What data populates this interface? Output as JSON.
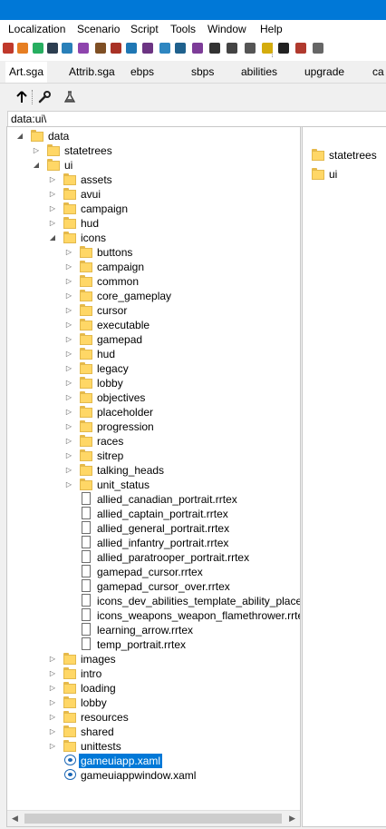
{
  "menu": [
    "Localization",
    "Scenario",
    "Script",
    "Tools",
    "Window",
    "Help"
  ],
  "toolbar_icons": [
    {
      "name": "red-cube-icon",
      "color": "#c0392b"
    },
    {
      "name": "palette-icon",
      "color": "#e67e22"
    },
    {
      "name": "plant-icon",
      "color": "#27ae60"
    },
    {
      "name": "swap-arrows-icon",
      "color": "#2c3e50"
    },
    {
      "name": "marker-icon",
      "color": "#2980b9"
    },
    {
      "name": "image-edit-icon",
      "color": "#8e44ad"
    },
    {
      "name": "grid-icon",
      "color": "#7f4f24"
    },
    {
      "name": "brush-icon",
      "color": "#a93226"
    },
    {
      "name": "snowflake-icon",
      "color": "#1f77b4"
    },
    {
      "name": "shield-icon",
      "color": "#6c3483"
    },
    {
      "name": "water-drop-icon",
      "color": "#2e86c1"
    },
    {
      "name": "wave-icon",
      "color": "#1f618d"
    },
    {
      "name": "chart-icon",
      "color": "#7d3c98"
    },
    {
      "name": "target-icon",
      "color": "#333333"
    },
    {
      "name": "bounding-box-icon",
      "color": "#444444"
    },
    {
      "name": "speaker-icon",
      "color": "#555555"
    },
    {
      "name": "lightbulb-icon",
      "color": "#d4ac0d"
    },
    {
      "name": "bomb-icon",
      "color": "#222222"
    },
    {
      "name": "flag-icon",
      "color": "#b03a2e"
    },
    {
      "name": "lock-icon",
      "color": "#666666"
    }
  ],
  "tabs": [
    "Art.sga",
    "Attrib.sga",
    "ebps",
    "sbps",
    "abilities",
    "upgrade",
    "ca"
  ],
  "subtoolbar": {
    "up_icon": "up-arrow-icon",
    "wrench_icon": "wrench-icon",
    "flask_icon": "flask-icon"
  },
  "path": "data:ui\\",
  "tree": [
    {
      "label": "data",
      "level": 0,
      "type": "folder",
      "expander": "open"
    },
    {
      "label": "statetrees",
      "level": 1,
      "type": "folder",
      "expander": "closed"
    },
    {
      "label": "ui",
      "level": 1,
      "type": "folder",
      "expander": "open"
    },
    {
      "label": "assets",
      "level": 2,
      "type": "folder",
      "expander": "closed"
    },
    {
      "label": "avui",
      "level": 2,
      "type": "folder",
      "expander": "closed"
    },
    {
      "label": "campaign",
      "level": 2,
      "type": "folder",
      "expander": "closed"
    },
    {
      "label": "hud",
      "level": 2,
      "type": "folder",
      "expander": "closed"
    },
    {
      "label": "icons",
      "level": 2,
      "type": "folder",
      "expander": "open"
    },
    {
      "label": "buttons",
      "level": 3,
      "type": "folder",
      "expander": "closed"
    },
    {
      "label": "campaign",
      "level": 3,
      "type": "folder",
      "expander": "closed"
    },
    {
      "label": "common",
      "level": 3,
      "type": "folder",
      "expander": "closed"
    },
    {
      "label": "core_gameplay",
      "level": 3,
      "type": "folder",
      "expander": "closed"
    },
    {
      "label": "cursor",
      "level": 3,
      "type": "folder",
      "expander": "closed"
    },
    {
      "label": "executable",
      "level": 3,
      "type": "folder",
      "expander": "closed"
    },
    {
      "label": "gamepad",
      "level": 3,
      "type": "folder",
      "expander": "closed"
    },
    {
      "label": "hud",
      "level": 3,
      "type": "folder",
      "expander": "closed"
    },
    {
      "label": "legacy",
      "level": 3,
      "type": "folder",
      "expander": "closed"
    },
    {
      "label": "lobby",
      "level": 3,
      "type": "folder",
      "expander": "closed"
    },
    {
      "label": "objectives",
      "level": 3,
      "type": "folder",
      "expander": "closed"
    },
    {
      "label": "placeholder",
      "level": 3,
      "type": "folder",
      "expander": "closed"
    },
    {
      "label": "progression",
      "level": 3,
      "type": "folder",
      "expander": "closed"
    },
    {
      "label": "races",
      "level": 3,
      "type": "folder",
      "expander": "closed"
    },
    {
      "label": "sitrep",
      "level": 3,
      "type": "folder",
      "expander": "closed"
    },
    {
      "label": "talking_heads",
      "level": 3,
      "type": "folder",
      "expander": "closed"
    },
    {
      "label": "unit_status",
      "level": 3,
      "type": "folder",
      "expander": "closed"
    },
    {
      "label": "allied_canadian_portrait.rrtex",
      "level": 3,
      "type": "file",
      "expander": "none"
    },
    {
      "label": "allied_captain_portrait.rrtex",
      "level": 3,
      "type": "file",
      "expander": "none"
    },
    {
      "label": "allied_general_portrait.rrtex",
      "level": 3,
      "type": "file",
      "expander": "none"
    },
    {
      "label": "allied_infantry_portrait.rrtex",
      "level": 3,
      "type": "file",
      "expander": "none"
    },
    {
      "label": "allied_paratrooper_portrait.rrtex",
      "level": 3,
      "type": "file",
      "expander": "none"
    },
    {
      "label": "gamepad_cursor.rrtex",
      "level": 3,
      "type": "file",
      "expander": "none"
    },
    {
      "label": "gamepad_cursor_over.rrtex",
      "level": 3,
      "type": "file",
      "expander": "none"
    },
    {
      "label": "icons_dev_abilities_template_ability_place",
      "level": 3,
      "type": "file",
      "expander": "none"
    },
    {
      "label": "icons_weapons_weapon_flamethrower.rrte",
      "level": 3,
      "type": "file",
      "expander": "none"
    },
    {
      "label": "learning_arrow.rrtex",
      "level": 3,
      "type": "file",
      "expander": "none"
    },
    {
      "label": "temp_portrait.rrtex",
      "level": 3,
      "type": "file",
      "expander": "none"
    },
    {
      "label": "images",
      "level": 2,
      "type": "folder",
      "expander": "closed"
    },
    {
      "label": "intro",
      "level": 2,
      "type": "folder",
      "expander": "closed"
    },
    {
      "label": "loading",
      "level": 2,
      "type": "folder",
      "expander": "closed"
    },
    {
      "label": "lobby",
      "level": 2,
      "type": "folder",
      "expander": "closed"
    },
    {
      "label": "resources",
      "level": 2,
      "type": "folder",
      "expander": "closed"
    },
    {
      "label": "shared",
      "level": 2,
      "type": "folder",
      "expander": "closed"
    },
    {
      "label": "unittests",
      "level": 2,
      "type": "folder",
      "expander": "closed"
    },
    {
      "label": "gameuiapp.xaml",
      "level": 2,
      "type": "xaml",
      "expander": "none",
      "selected": true
    },
    {
      "label": "gameuiappwindow.xaml",
      "level": 2,
      "type": "xaml",
      "expander": "none"
    }
  ],
  "right_pane": [
    {
      "label": "statetrees",
      "type": "folder"
    },
    {
      "label": "ui",
      "type": "folder"
    }
  ],
  "colors": {
    "title_bar": "#0078d7",
    "selection": "#0078d7",
    "folder": "#ffd766"
  }
}
